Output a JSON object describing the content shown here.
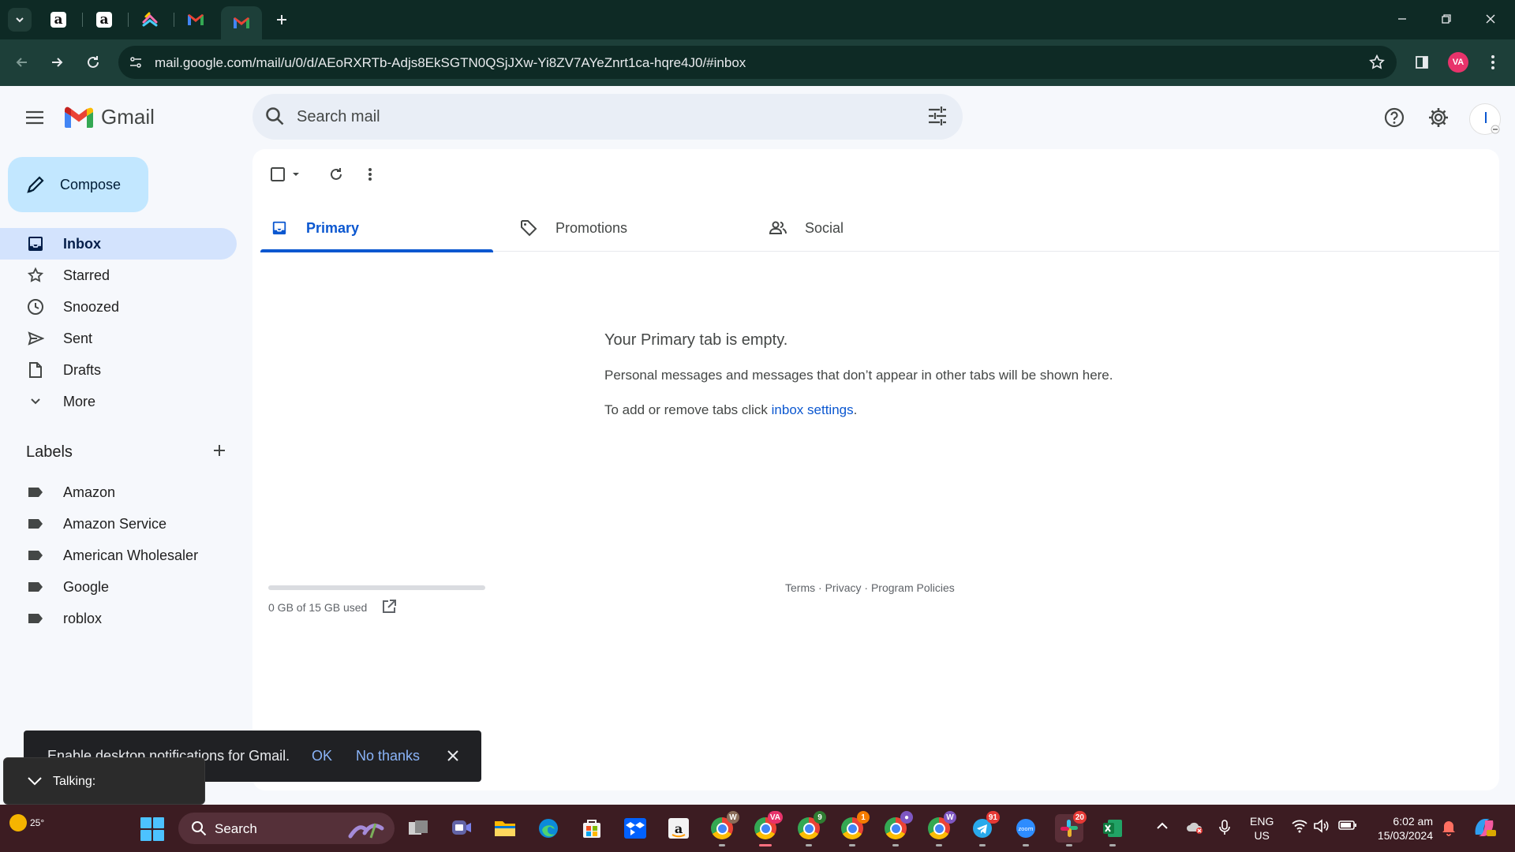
{
  "browser": {
    "tabs": [
      {
        "icon": "amazon-favicon",
        "letter": "a"
      },
      {
        "icon": "amazon-favicon",
        "letter": "a"
      },
      {
        "icon": "clickup-favicon"
      },
      {
        "icon": "gmail-favicon"
      },
      {
        "icon": "gmail-favicon",
        "active": true
      }
    ],
    "url": "mail.google.com/mail/u/0/d/AEoRXRTb-Adjs8EkSGTN0QSjJXw-Yi8ZV7AYeZnrt1ca-hqre4J0/#inbox",
    "profile_initials": "VA",
    "accent": "#1d3f39"
  },
  "gmail": {
    "logo_text": "Gmail",
    "search_placeholder": "Search mail",
    "compose_label": "Compose",
    "nav": [
      {
        "label": "Inbox",
        "icon": "inbox-icon",
        "active": true
      },
      {
        "label": "Starred",
        "icon": "star-icon"
      },
      {
        "label": "Snoozed",
        "icon": "clock-icon"
      },
      {
        "label": "Sent",
        "icon": "send-icon"
      },
      {
        "label": "Drafts",
        "icon": "draft-icon"
      },
      {
        "label": "More",
        "icon": "chevron-down-icon"
      }
    ],
    "labels_title": "Labels",
    "labels": [
      "Amazon",
      "Amazon Service",
      "American Wholesaler",
      "Google",
      "roblox"
    ],
    "tabs": [
      {
        "label": "Primary",
        "icon": "inbox-icon",
        "active": true
      },
      {
        "label": "Promotions",
        "icon": "tag-icon"
      },
      {
        "label": "Social",
        "icon": "people-icon"
      }
    ],
    "empty": {
      "title": "Your Primary tab is empty.",
      "line1": "Personal messages and messages that don’t appear in other tabs will be shown here.",
      "line2_prefix": "To add or remove tabs click ",
      "line2_link": "inbox settings",
      "line2_suffix": "."
    },
    "storage": {
      "text": "0 GB of 15 GB used",
      "used_fraction": 0
    },
    "footer": [
      "Terms",
      "Privacy",
      "Program Policies"
    ],
    "footer_sep": " · "
  },
  "snackbar": {
    "text": "Enable desktop notifications for Gmail.",
    "ok": "OK",
    "no": "No thanks"
  },
  "talking": {
    "label": "Talking:"
  },
  "taskbar": {
    "temperature": "25°",
    "search_label": "Search",
    "badges": {
      "chrome_va": "VA",
      "chrome_9": "9",
      "chrome_1": "1",
      "telegram": "91",
      "slack": "20"
    },
    "lang_1": "ENG",
    "lang_2": "US",
    "time": "6:02 am",
    "date": "15/03/2024"
  }
}
